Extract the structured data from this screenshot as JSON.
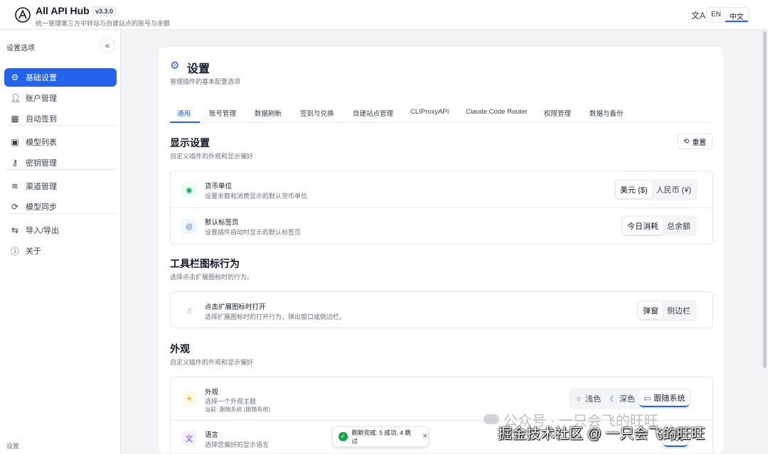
{
  "header": {
    "title": "All API Hub",
    "version": "v3.3.0",
    "subtitle": "统一管理第三方中转站与自建站点的账号与余额",
    "lang": {
      "en": "EN",
      "zh": "中文"
    }
  },
  "sidebar": {
    "title": "设置选项",
    "items": [
      {
        "label": "基础设置",
        "icon": "gear-icon"
      },
      {
        "label": "账户管理",
        "icon": "user-icon"
      },
      {
        "label": "自动签到",
        "icon": "calendar-icon"
      },
      {
        "label": "模型列表",
        "icon": "chip-icon"
      },
      {
        "label": "密钥管理",
        "icon": "key-icon"
      },
      {
        "label": "渠道管理",
        "icon": "layers-icon"
      },
      {
        "label": "模型同步",
        "icon": "sync-icon"
      },
      {
        "label": "导入/导出",
        "icon": "swap-icon"
      },
      {
        "label": "关于",
        "icon": "info-icon"
      }
    ],
    "footer": "设置"
  },
  "page": {
    "title": "设置",
    "subtitle": "管理插件的基本配置选项",
    "tabs": [
      "通用",
      "账号管理",
      "数据刷新",
      "签到与兑换",
      "自建站点管理",
      "CLIProxyAPI",
      "Claude Code Router",
      "权限管理",
      "数据与备份"
    ]
  },
  "display": {
    "title": "显示设置",
    "subtitle": "自定义插件的外观和显示偏好",
    "reset": "重置",
    "currency": {
      "label": "货币单位",
      "desc": "设置余额和消费显示的默认货币单位",
      "options": [
        "美元 ($)",
        "人民币 (¥)"
      ]
    },
    "default_tab": {
      "label": "默认标签页",
      "desc": "设置插件启动时显示的默认标签页",
      "options": [
        "今日消耗",
        "总余额"
      ]
    }
  },
  "toolbar": {
    "title": "工具栏图标行为",
    "subtitle": "选择点击扩展图标时的行为。",
    "open": {
      "label": "点击扩展图标时打开",
      "desc": "选择扩展图标时的打开行为，弹出窗口或侧边栏。",
      "options": [
        "弹窗",
        "侧边栏"
      ]
    }
  },
  "appearance": {
    "title": "外观",
    "subtitle": "自定义插件的外观和显示偏好",
    "theme": {
      "label": "外观",
      "desc": "选择一个外观主题",
      "current": "当前: 跟随系统 (跟随系统)",
      "options": [
        "浅色",
        "深色",
        "跟随系统"
      ]
    },
    "language": {
      "label": "语言",
      "desc": "选择您偏好的显示语言",
      "option": "中文"
    }
  },
  "toast": {
    "message": "刷新完成: 5 成功, 4 跳过"
  },
  "watermark": {
    "line1": "公众号 · 一只会飞的旺旺",
    "line2": "掘金技术社区 @ 一只会飞的旺旺"
  },
  "colors": {
    "accent": "#2563eb",
    "success": "#16a34a"
  }
}
